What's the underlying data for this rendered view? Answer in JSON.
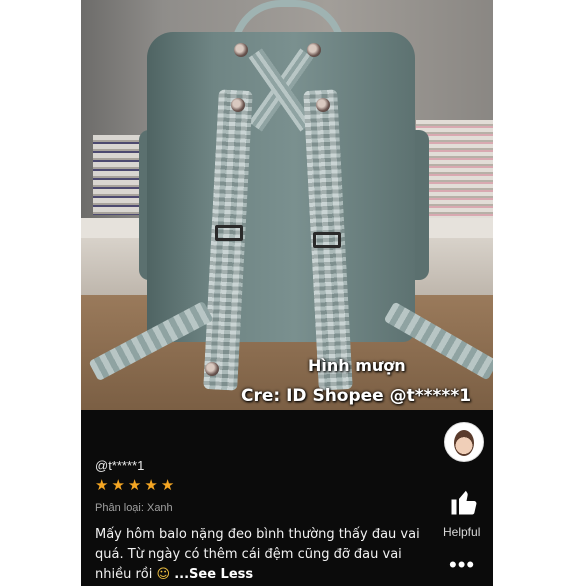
{
  "photo": {
    "caption_line1": "Hình mượn",
    "caption_line2": "Cre: ID Shopee @t*****1"
  },
  "review": {
    "username": "@t*****1",
    "rating": 5,
    "stars": [
      "★",
      "★",
      "★",
      "★",
      "★"
    ],
    "variant_label": "Phân loại: Xanh",
    "text": "Mấy hôm balo nặng đeo bình thường thấy đau vai quá. Từ ngày có thêm cái đệm cũng đỡ đau vai nhiều rồi ",
    "emoji": "☺",
    "see_less": "...See Less"
  },
  "actions": {
    "helpful_label": "Helpful",
    "more_label": "•••"
  },
  "colors": {
    "star": "#f5a623",
    "background": "#0b0b0b",
    "text": "#f2f2f2"
  },
  "icons": [
    "avatar",
    "thumbs-up-icon",
    "more-icon"
  ]
}
